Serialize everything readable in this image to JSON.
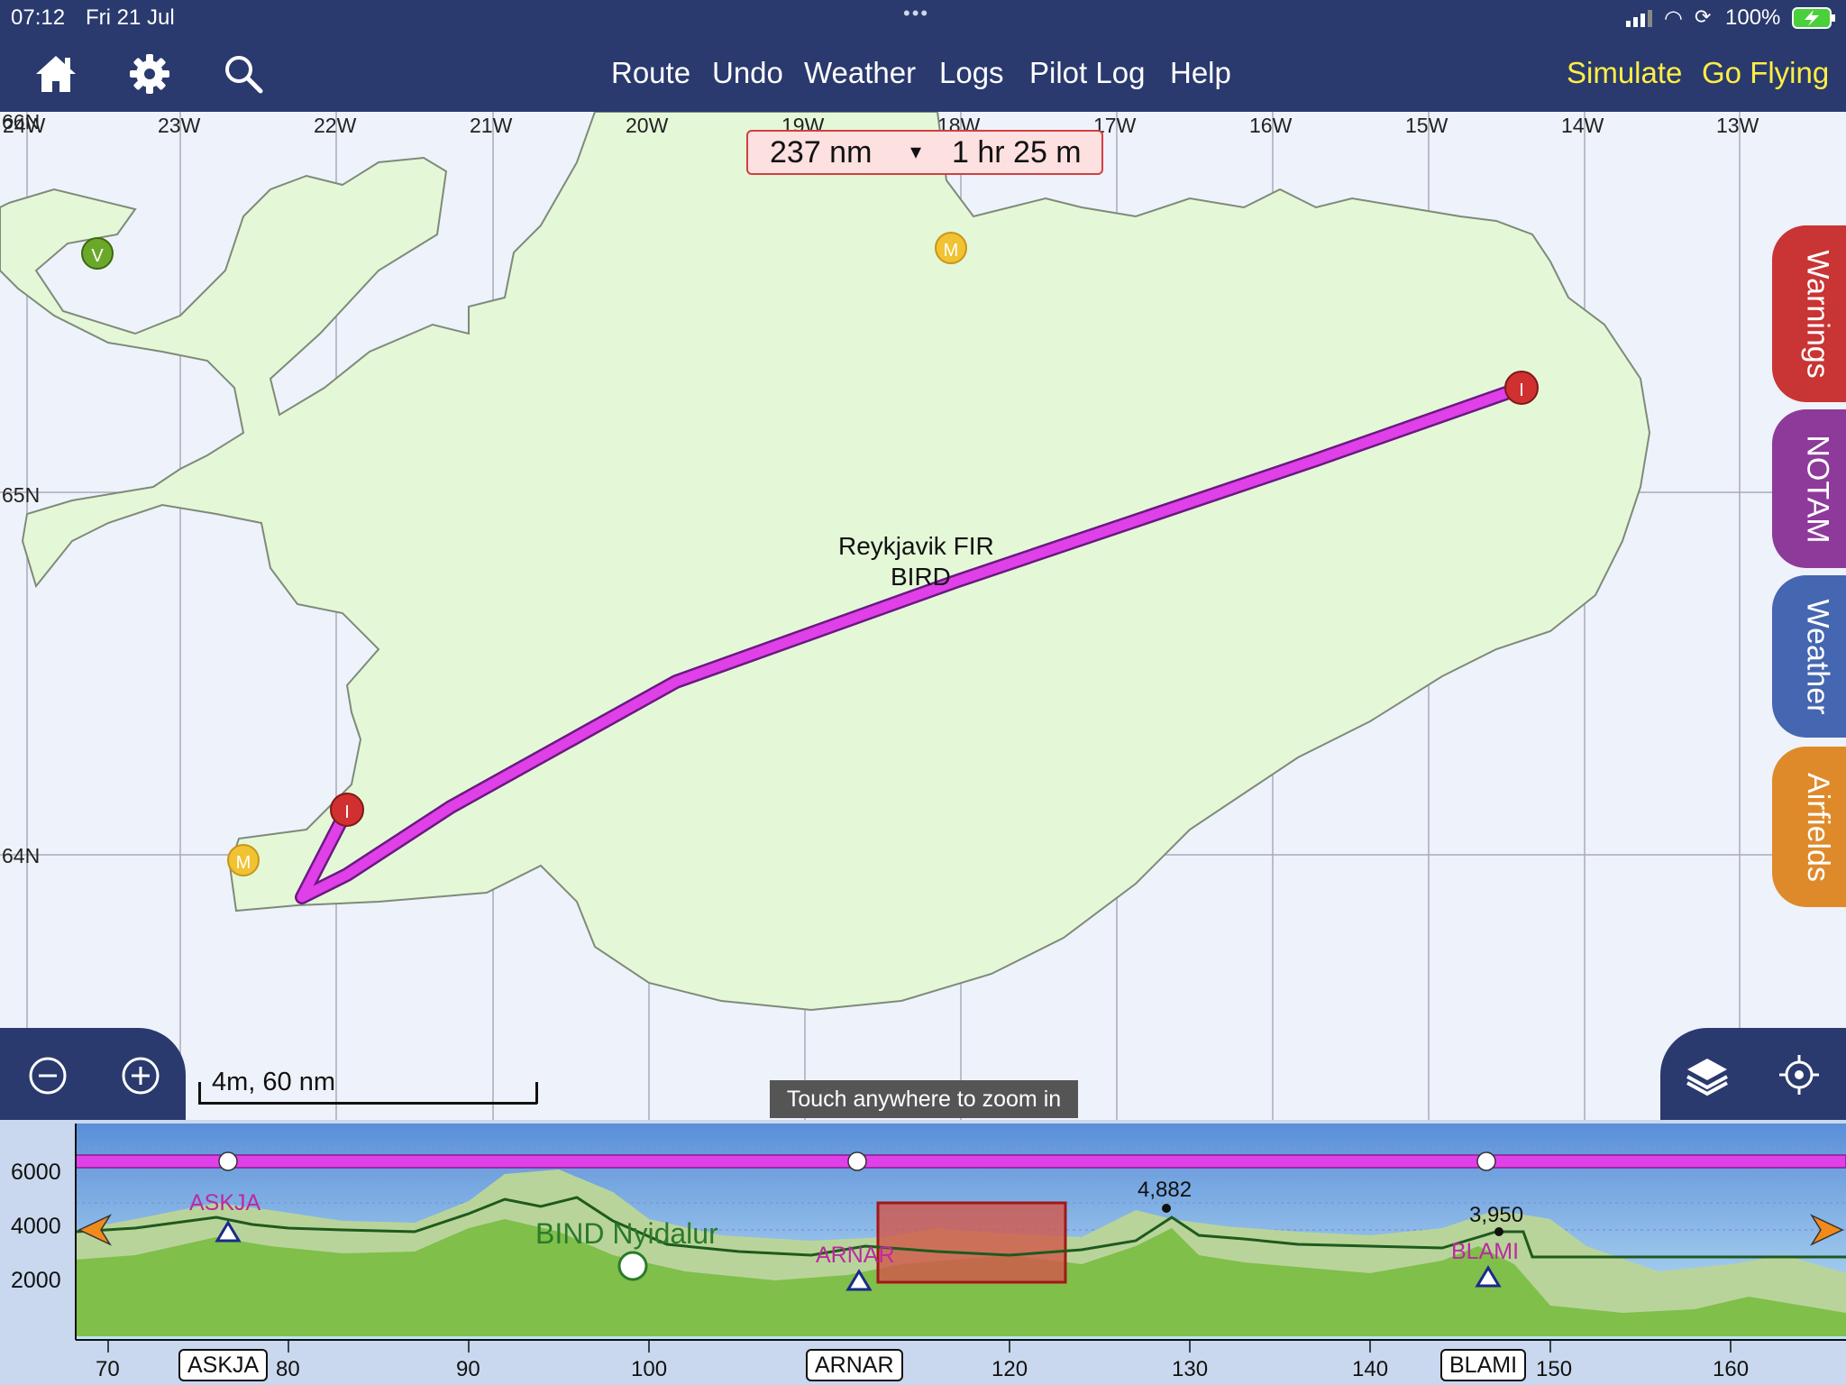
{
  "status_bar": {
    "time": "07:12",
    "date": "Fri 21 Jul",
    "battery": "100%"
  },
  "toolbar": {
    "home_icon": "home-icon",
    "settings_icon": "gear-icon",
    "search_icon": "search-icon",
    "menu": [
      "Route",
      "Undo",
      "Weather",
      "Logs",
      "Pilot Log",
      "Help"
    ],
    "simulate": "Simulate",
    "go_flying": "Go Flying"
  },
  "map": {
    "longitudes": [
      "24W",
      "23W",
      "22W",
      "21W",
      "20W",
      "19W",
      "18W",
      "17W",
      "16W",
      "15W",
      "14W",
      "13W"
    ],
    "latitudes": [
      "66N",
      "65N",
      "64N"
    ],
    "fir_name": "Reykjavik FIR",
    "fir_code": "BIRD",
    "markers": [
      {
        "label": "V",
        "color": "#6aa82a"
      },
      {
        "label": "M",
        "color": "#f1c232"
      },
      {
        "label": "M",
        "color": "#f1c232"
      },
      {
        "label": "I",
        "color": "#d03030"
      },
      {
        "label": "I",
        "color": "#d03030"
      }
    ],
    "route_color": "#e040e8",
    "land_color": "#e4f8d8"
  },
  "route_summary": {
    "distance": "237 nm",
    "time": "1 hr 25 m"
  },
  "side_tabs": [
    {
      "label": "Warnings",
      "color": "#c93434"
    },
    {
      "label": "NOTAM",
      "color": "#8e3a9a"
    },
    {
      "label": "Weather",
      "color": "#4566b0"
    },
    {
      "label": "Airfields",
      "color": "#df8a2a"
    }
  ],
  "zoom": {
    "zoom_out_icon": "minus-circle-icon",
    "zoom_in_icon": "plus-circle-icon",
    "scale": "4m, 60 nm",
    "hint": "Touch anywhere to zoom in",
    "layers_icon": "layers-icon",
    "locate_icon": "crosshair-icon"
  },
  "profile": {
    "y_ticks": [
      "6000",
      "4000",
      "2000"
    ],
    "x_ticks": [
      "70",
      "80",
      "90",
      "100",
      "120",
      "130",
      "140",
      "150",
      "160"
    ],
    "waypoints": [
      "ASKJA",
      "ARNAR",
      "BLAMI"
    ],
    "airspace_label": "BIND Nyidalur",
    "peaks": [
      "4,882",
      "3,950"
    ]
  }
}
